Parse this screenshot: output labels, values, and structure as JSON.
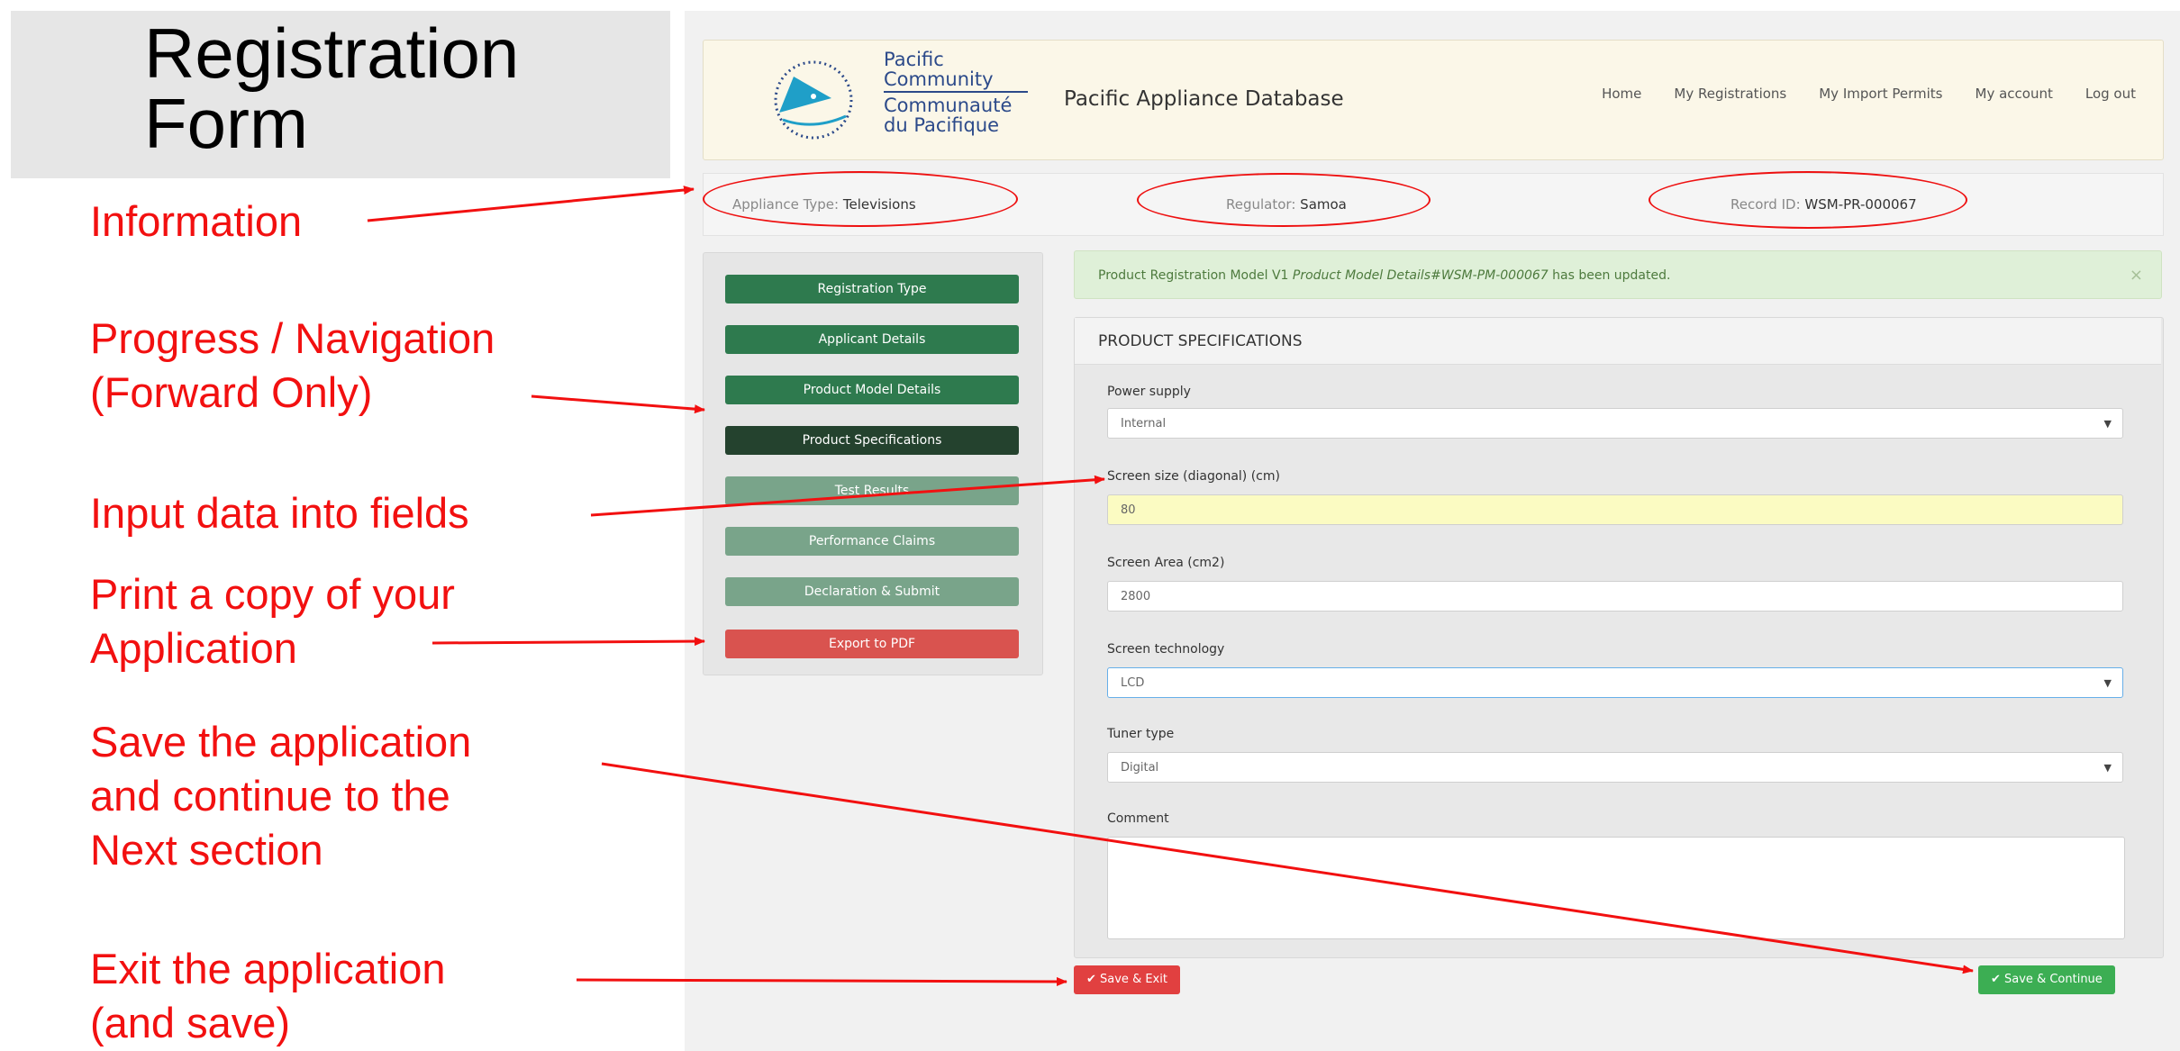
{
  "slide_title": [
    "Registration",
    "Form"
  ],
  "app": {
    "logo_text": [
      "Pacific",
      "Community",
      "Communauté",
      "du Pacifique"
    ],
    "name": "Pacific Appliance Database",
    "nav": [
      "Home",
      "My Registrations",
      "My Import Permits",
      "My account",
      "Log out"
    ]
  },
  "info": {
    "appliance_label": "Appliance Type:",
    "appliance_value": "Televisions",
    "regulator_label": "Regulator:",
    "regulator_value": "Samoa",
    "record_label": "Record ID:",
    "record_value": "WSM-PR-000067"
  },
  "steps": [
    {
      "label": "Registration Type",
      "state": "done"
    },
    {
      "label": "Applicant Details",
      "state": "done"
    },
    {
      "label": "Product Model Details",
      "state": "done"
    },
    {
      "label": "Product Specifications",
      "state": "active"
    },
    {
      "label": "Test Results",
      "state": "todo"
    },
    {
      "label": "Performance Claims",
      "state": "todo"
    },
    {
      "label": "Declaration & Submit",
      "state": "todo"
    }
  ],
  "export_label": "Export to PDF",
  "alert": {
    "prefix": "Product Registration Model V1",
    "italic": "Product Model Details#WSM-PM-000067",
    "suffix": "has been updated.",
    "close": "×"
  },
  "form": {
    "heading": "PRODUCT SPECIFICATIONS",
    "power_supply": {
      "label": "Power supply",
      "value": "Internal"
    },
    "screen_size": {
      "label": "Screen size (diagonal) (cm)",
      "value": "80"
    },
    "screen_area": {
      "label": "Screen Area (cm2)",
      "value": "2800"
    },
    "screen_tech": {
      "label": "Screen technology",
      "value": "LCD"
    },
    "tuner": {
      "label": "Tuner type",
      "value": "Digital"
    },
    "comment": {
      "label": "Comment",
      "value": ""
    }
  },
  "buttons": {
    "exit": "✔ Save & Exit",
    "continue": "✔ Save & Continue"
  },
  "annotations": {
    "information": "Information",
    "progress": [
      "Progress / Navigation",
      "(Forward Only)"
    ],
    "input": "Input data into fields",
    "print": [
      "Print a copy of your",
      "Application"
    ],
    "save": [
      "Save the application",
      "and continue to the",
      "Next section"
    ],
    "exit": [
      "Exit the application",
      "(and save)"
    ]
  },
  "colors": {
    "annotation_red": "#f21010",
    "step_done": "#2e7a4e",
    "step_active": "#24422e",
    "step_todo": "#79a48a",
    "export_red": "#d9534f",
    "save_exit_red": "#e14040",
    "save_continue_green": "#3cae53"
  }
}
